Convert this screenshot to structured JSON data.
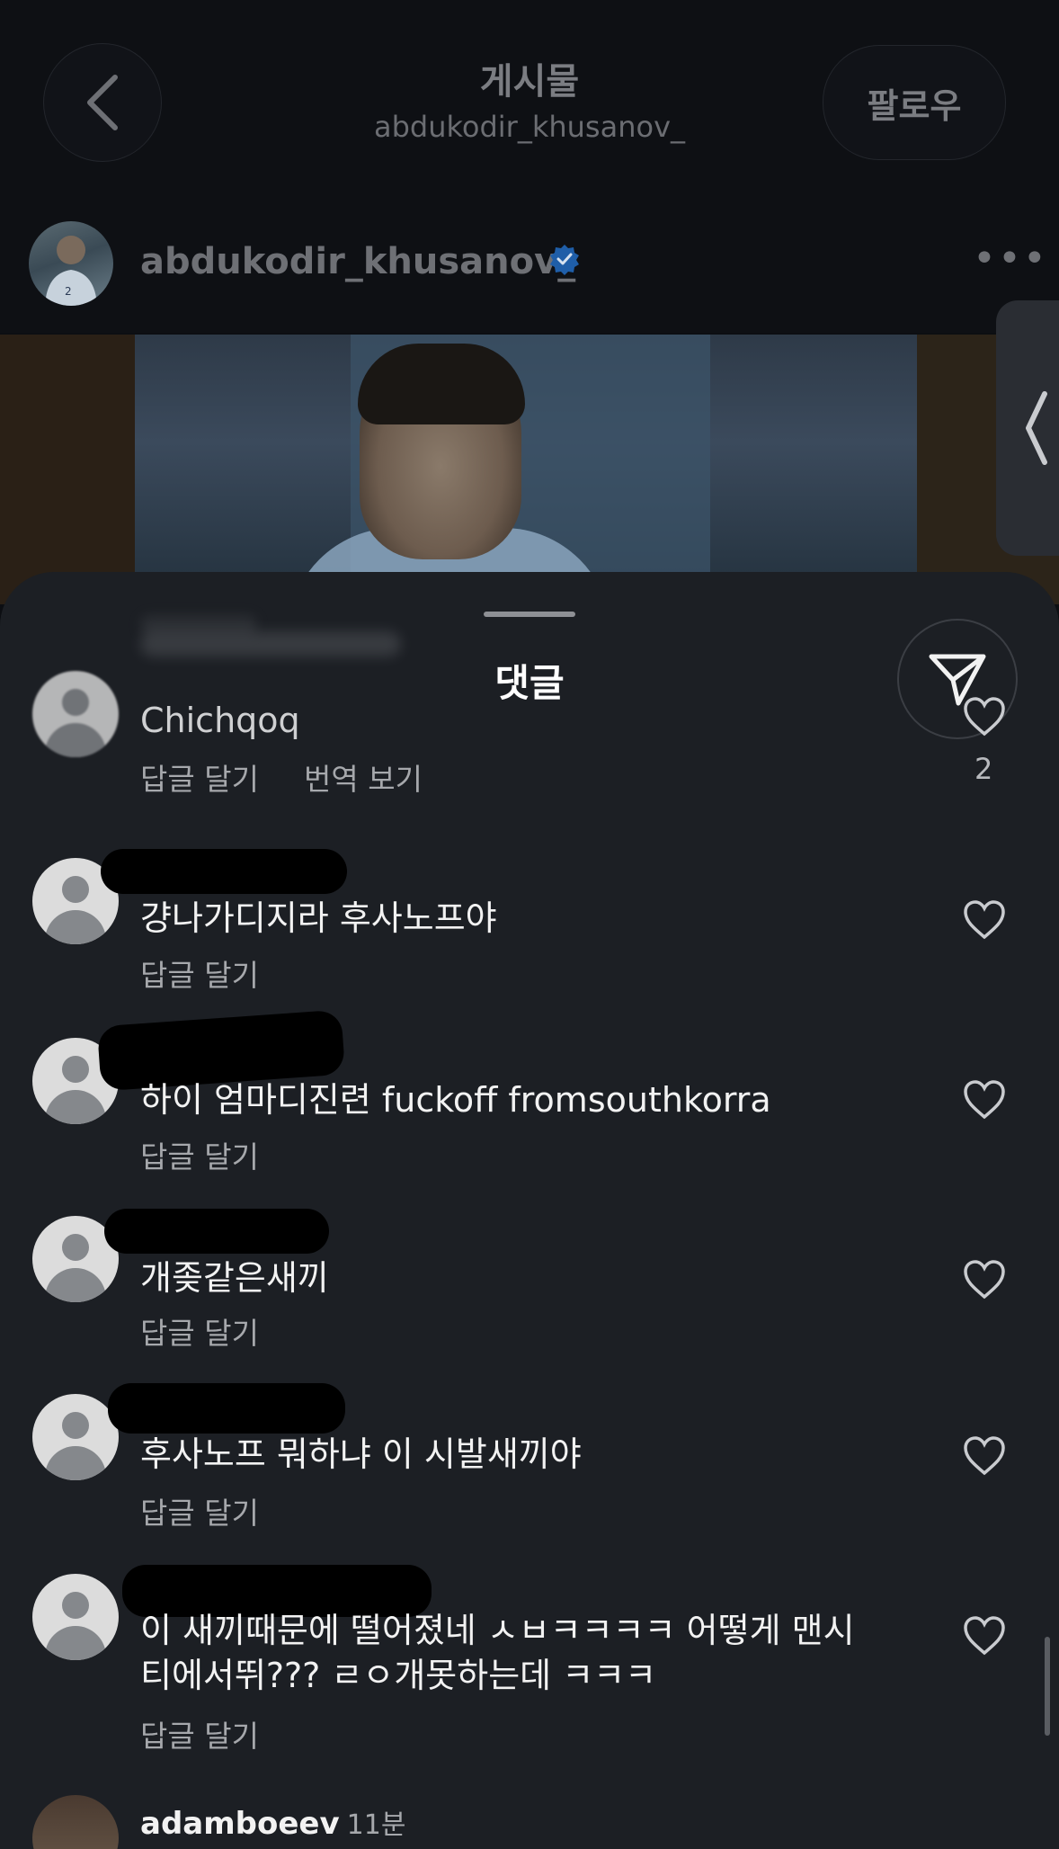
{
  "header": {
    "title": "게시물",
    "subtitle": "abdukodir_khusanov_",
    "follow_label": "팔로우"
  },
  "post": {
    "author": "abdukodir_khusanov_",
    "verified": true,
    "more_label": "•••"
  },
  "sheet": {
    "title": "댓글"
  },
  "comments": [
    {
      "text": "Chichqoq",
      "reply_label": "답글 달기",
      "translate_label": "번역 보기",
      "likes": "2"
    },
    {
      "text": "걍나가디지라 후사노프야",
      "reply_label": "답글 달기"
    },
    {
      "text": "하이 엄마디진련 fuckoff fromsouthkorra",
      "reply_label": "답글 달기"
    },
    {
      "text": "개좆같은새끼",
      "reply_label": "답글 달기"
    },
    {
      "text": "후사노프 뭐하냐 이 시발새끼야",
      "reply_label": "답글 달기"
    },
    {
      "text_line1": "이 새끼때문에 떨어졌네 ㅅㅂㅋㅋㅋㅋ 어떻게 맨시",
      "text_line2": "티에서뛰??? ㄹㅇ개못하는데 ㅋㅋㅋ",
      "reply_label": "답글 달기"
    }
  ],
  "last_comment": {
    "username": "adamboeev",
    "time": "11분"
  },
  "colors": {
    "background": "#0c0e12",
    "sheet": "#1c1f24",
    "verified": "#0095f6"
  },
  "icons": [
    "back-chevron-icon",
    "verified-badge-icon",
    "more-icon",
    "side-chevron-icon",
    "share-icon",
    "heart-icon"
  ]
}
